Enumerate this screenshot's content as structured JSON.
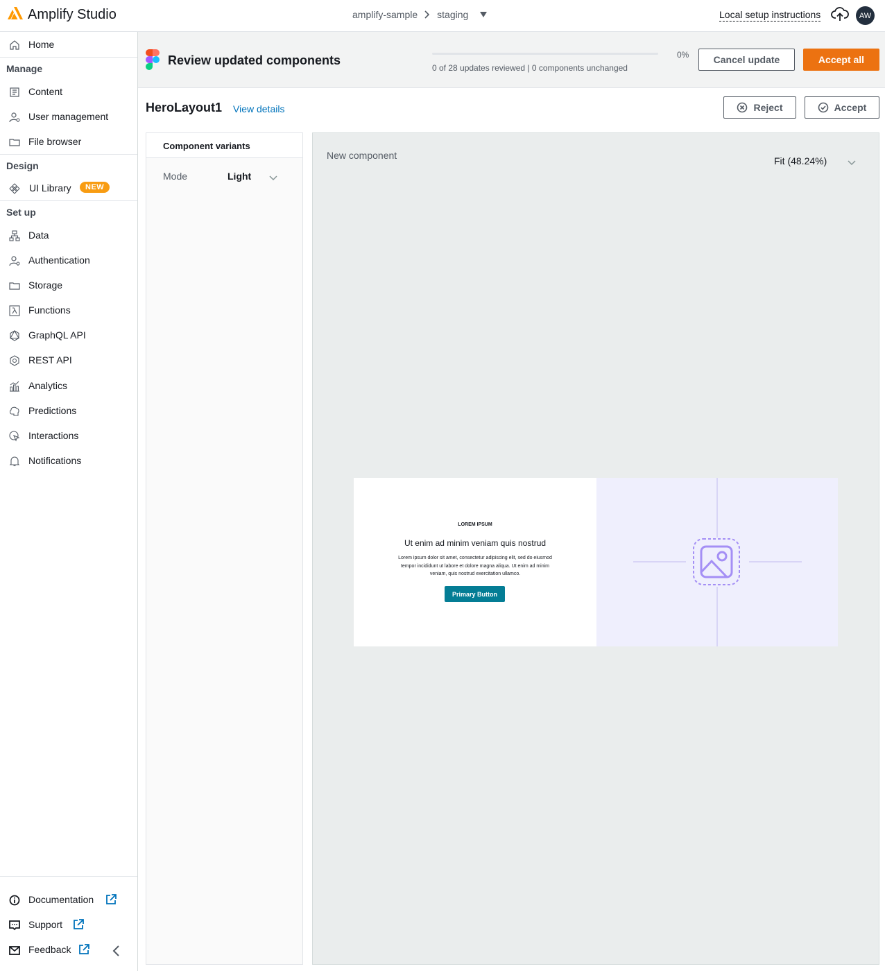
{
  "app": {
    "title": "Amplify Studio"
  },
  "breadcrumb": {
    "app_name": "amplify-sample",
    "environment": "staging"
  },
  "header": {
    "setup_link": "Local setup instructions",
    "avatar_initials": "AW"
  },
  "sidebar": {
    "home": "Home",
    "manage_title": "Manage",
    "manage_items": [
      "Content",
      "User management",
      "File browser"
    ],
    "design_title": "Design",
    "design_items": [
      "UI Library"
    ],
    "new_badge": "NEW",
    "setup_title": "Set up",
    "setup_items": [
      "Data",
      "Authentication",
      "Storage",
      "Functions",
      "GraphQL API",
      "REST API",
      "Analytics",
      "Predictions",
      "Interactions",
      "Notifications"
    ],
    "footer_items": [
      "Documentation",
      "Support",
      "Feedback"
    ]
  },
  "review": {
    "title": "Review updated components",
    "progress_percent": "0%",
    "progress_value": 0,
    "progress_desc": "0 of 28 updates reviewed | 0 components unchanged",
    "cancel_label": "Cancel update",
    "accept_all_label": "Accept all"
  },
  "component": {
    "name": "HeroLayout1",
    "view_details": "View details",
    "reject_label": "Reject",
    "accept_label": "Accept"
  },
  "variants": {
    "title": "Component variants",
    "mode_label": "Mode",
    "mode_value": "Light"
  },
  "preview": {
    "label": "New component",
    "zoom": "Fit (48.24%)",
    "hero": {
      "eyebrow": "LOREM IPSUM",
      "heading": "Ut enim ad minim veniam quis nostrud",
      "body": "Lorem ipsum dolor sit amet, consectetur adipiscing elit, sed do eiusmod tempor incididunt ut labore et dolore magna aliqua. Ut enim ad minim veniam, quis nostrud exercitation ullamco.",
      "button": "Primary Button"
    }
  },
  "colors": {
    "accent": "#ec7211",
    "link": "#0073bb",
    "hero_button": "#047d95",
    "hero_image_bg": "#efeffd",
    "image_icon": "#a48ff5"
  }
}
